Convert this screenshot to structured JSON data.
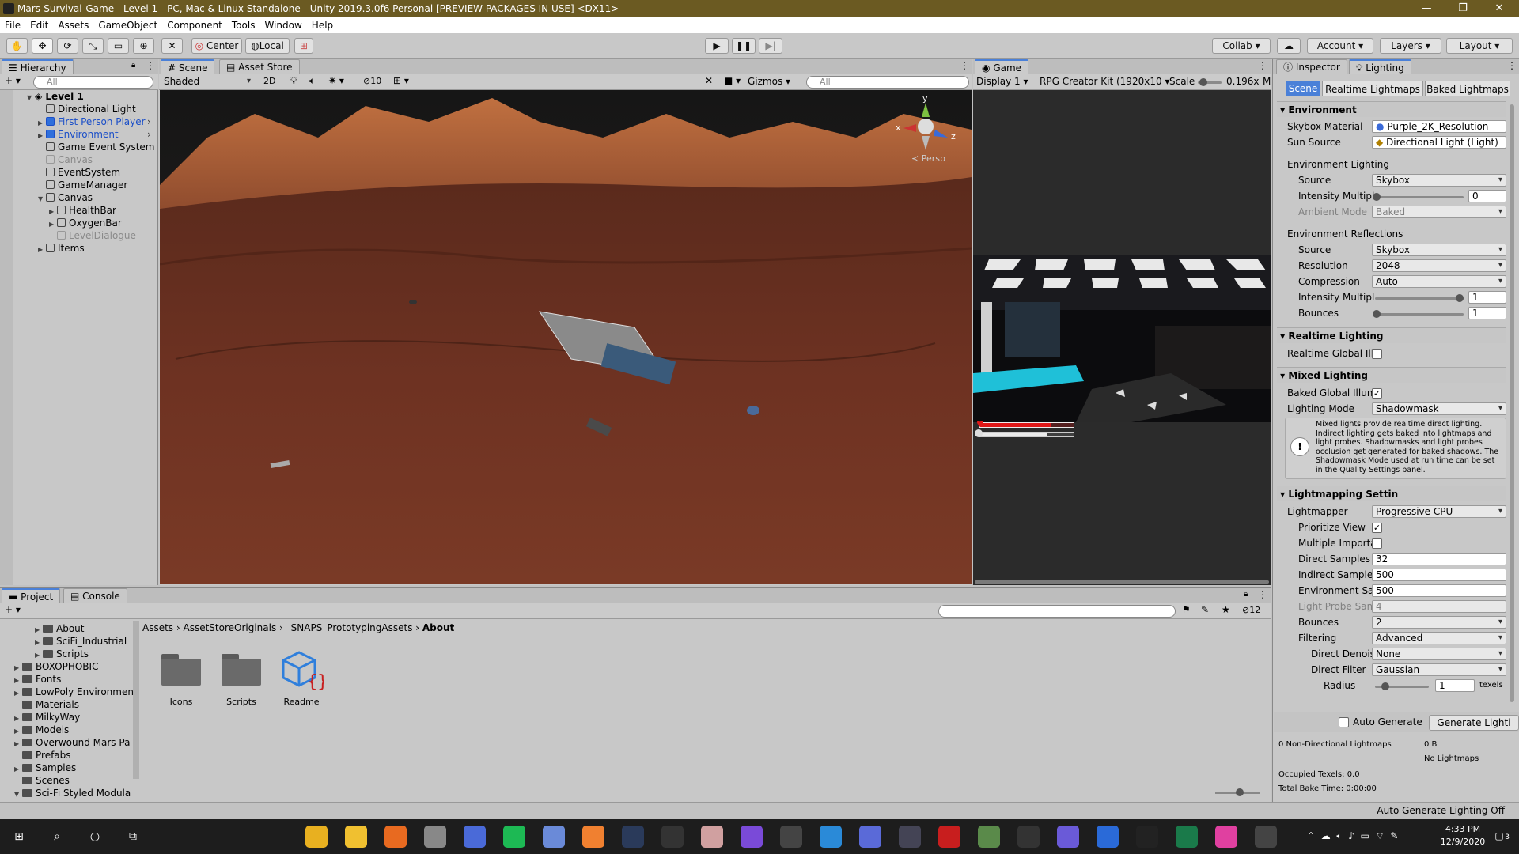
{
  "window": {
    "title": "Mars-Survival-Game - Level 1 - PC, Mac & Linux Standalone - Unity 2019.3.0f6 Personal [PREVIEW PACKAGES IN USE] <DX11>"
  },
  "menu": [
    "File",
    "Edit",
    "Assets",
    "GameObject",
    "Component",
    "Tools",
    "Window",
    "Help"
  ],
  "toolbar": {
    "pivot": "Center",
    "space": "Local",
    "collab": "Collab",
    "account": "Account",
    "layers": "Layers",
    "layout": "Layout"
  },
  "hierarchy": {
    "tab": "Hierarchy",
    "search_placeholder": "All",
    "scene": "Level 1",
    "items": [
      {
        "label": "Directional Light",
        "state": "normal"
      },
      {
        "label": "First Person Player",
        "state": "prefab"
      },
      {
        "label": "Environment",
        "state": "prefab"
      },
      {
        "label": "Game Event System",
        "state": "normal"
      },
      {
        "label": "Canvas",
        "state": "disabled"
      },
      {
        "label": "EventSystem",
        "state": "normal"
      },
      {
        "label": "GameManager",
        "state": "normal"
      },
      {
        "label": "Canvas",
        "state": "normal"
      },
      {
        "label": "HealthBar",
        "state": "normal"
      },
      {
        "label": "OxygenBar",
        "state": "normal"
      },
      {
        "label": "LevelDialogue",
        "state": "disabled"
      },
      {
        "label": "Items",
        "state": "normal"
      }
    ]
  },
  "scene_view": {
    "tabs": [
      "Scene",
      "Asset Store"
    ],
    "shading": "Shaded",
    "mode_2d": "2D",
    "hidden_count": "10",
    "gizmos": "Gizmos",
    "search_placeholder": "All",
    "persp_label": "Persp",
    "axis_x": "x",
    "axis_y": "y",
    "axis_z": "z"
  },
  "game_view": {
    "tab": "Game",
    "display": "Display 1",
    "resolution": "RPG Creator Kit (1920x10",
    "scale_label": "Scale",
    "scale_value": "0.196x",
    "maximize": "M",
    "health_fraction": 0.75,
    "oxygen_fraction": 0.72
  },
  "inspector": {
    "tabs": [
      "Inspector",
      "Lighting"
    ],
    "subtabs": [
      "Scene",
      "Realtime Lightmaps",
      "Baked Lightmaps"
    ],
    "environment": {
      "header": "Environment",
      "skybox_label": "Skybox Material",
      "skybox_value": "Purple_2K_Resolution",
      "sun_label": "Sun Source",
      "sun_value": "Directional Light (Light)",
      "env_lighting_header": "Environment Lighting",
      "source_label": "Source",
      "source_value": "Skybox",
      "intensity_label": "Intensity Multipl",
      "intensity_value": "0",
      "ambient_label": "Ambient Mode",
      "ambient_value": "Baked",
      "reflections_header": "Environment Reflections",
      "refl_source_label": "Source",
      "refl_source_value": "Skybox",
      "resolution_label": "Resolution",
      "resolution_value": "2048",
      "compression_label": "Compression",
      "compression_value": "Auto",
      "refl_intensity_label": "Intensity Multipl",
      "refl_intensity_value": "1",
      "bounces_label": "Bounces",
      "bounces_value": "1"
    },
    "realtime": {
      "header": "Realtime Lighting",
      "gi_label": "Realtime Global Illu"
    },
    "mixed": {
      "header": "Mixed Lighting",
      "baked_gi_label": "Baked Global Illum",
      "mode_label": "Lighting Mode",
      "mode_value": "Shadowmask",
      "info": "Mixed lights provide realtime direct lighting. Indirect lighting gets baked into lightmaps and light probes. Shadowmasks and light probes occlusion get generated for baked shadows. The Shadowmask Mode used at run time can be set in the Quality Settings panel."
    },
    "lightmapping": {
      "header": "Lightmapping Settin",
      "lightmapper_label": "Lightmapper",
      "lightmapper_value": "Progressive CPU",
      "prioritize_label": "Prioritize View",
      "multiple_label": "Multiple Importa",
      "direct_label": "Direct Samples",
      "direct_value": "32",
      "indirect_label": "Indirect Samples",
      "indirect_value": "500",
      "env_samples_label": "Environment Sa",
      "env_samples_value": "500",
      "probe_label": "Light Probe Sam",
      "probe_value": "4",
      "bounces_label": "Bounces",
      "bounces_value": "2",
      "filtering_label": "Filtering",
      "filtering_value": "Advanced",
      "denoiser_label": "Direct Denois",
      "denoiser_value": "None",
      "filter_label": "Direct Filter",
      "filter_value": "Gaussian",
      "radius_label": "Radius",
      "radius_value": "1",
      "radius_unit": "texels"
    },
    "auto_generate_label": "Auto Generate",
    "generate_button": "Generate Lighti",
    "stats": {
      "lightmaps_label": "0 Non-Directional Lightmaps",
      "lightmaps_size": "0 B",
      "no_lightmaps": "No Lightmaps",
      "texels": "Occupied Texels: 0.0",
      "bake_time": "Total Bake Time: 0:00:00"
    }
  },
  "project": {
    "tabs": [
      "Project",
      "Console"
    ],
    "hidden_count": "12",
    "tree": [
      {
        "label": "About",
        "indent": 3,
        "arrow": true
      },
      {
        "label": "SciFi_Industrial",
        "indent": 3,
        "arrow": true
      },
      {
        "label": "Scripts",
        "indent": 3,
        "arrow": true
      },
      {
        "label": "BOXOPHOBIC",
        "indent": 1,
        "arrow": true
      },
      {
        "label": "Fonts",
        "indent": 1,
        "arrow": true
      },
      {
        "label": "LowPoly Environmen",
        "indent": 1,
        "arrow": true
      },
      {
        "label": "Materials",
        "indent": 1,
        "arrow": false
      },
      {
        "label": "MilkyWay",
        "indent": 1,
        "arrow": true
      },
      {
        "label": "Models",
        "indent": 1,
        "arrow": true
      },
      {
        "label": "Overwound Mars Pa",
        "indent": 1,
        "arrow": true
      },
      {
        "label": "Prefabs",
        "indent": 1,
        "arrow": false
      },
      {
        "label": "Samples",
        "indent": 1,
        "arrow": true
      },
      {
        "label": "Scenes",
        "indent": 1,
        "arrow": false
      },
      {
        "label": "Sci-Fi Styled Modula",
        "indent": 1,
        "arrow": true
      }
    ],
    "breadcrumb": [
      "Assets",
      "AssetStoreOriginals",
      "_SNAPS_PrototypingAssets",
      "About"
    ],
    "assets": [
      {
        "label": "Icons",
        "kind": "folder"
      },
      {
        "label": "Scripts",
        "kind": "folder"
      },
      {
        "label": "Readme",
        "kind": "asset"
      }
    ]
  },
  "status_bar": {
    "text": "Auto Generate Lighting Off"
  },
  "taskbar": {
    "time": "4:33 PM",
    "date": "12/9/2020",
    "notifications": "3",
    "apps": [
      "Explorer",
      "Files",
      "Firefox",
      "Settings",
      "Calculator",
      "Spotify",
      "Snip",
      "Sublime",
      "Steam",
      "Unity Hub",
      "Anime",
      "Visual Studio",
      "Unity",
      "VS Code",
      "Discord",
      "Planet",
      "FileZilla",
      "Photos",
      "Notion",
      "Browser",
      "Remote",
      "Epic Games",
      "Xbox",
      "iTunes",
      "Unity Editor"
    ]
  },
  "colors": {
    "title_bg": "#6b5a22",
    "accent": "#4a80d8",
    "mars": "#7a3a24"
  }
}
